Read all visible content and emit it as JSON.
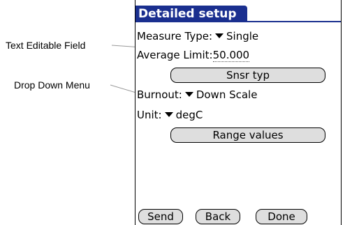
{
  "annotations": {
    "text_field_label": "Text Editable Field",
    "dropdown_label": "Drop Down Menu"
  },
  "form": {
    "title": "Detailed setup",
    "measure_type": {
      "label": "Measure Type:",
      "value": "Single"
    },
    "average_limit": {
      "label": "Average Limit:",
      "value": "50.000"
    },
    "sensor_type_button": "Snsr typ",
    "burnout": {
      "label": "Burnout:",
      "value": "Down Scale"
    },
    "unit": {
      "label": "Unit:",
      "value": "degC"
    },
    "range_values_button": "Range values"
  },
  "footer": {
    "send": "Send",
    "back": "Back",
    "done": "Done"
  },
  "colors": {
    "title_bar": "#1a2f8f",
    "button_fill": "#dedede"
  },
  "icons": {
    "dropdown": "triangle-down-icon"
  }
}
